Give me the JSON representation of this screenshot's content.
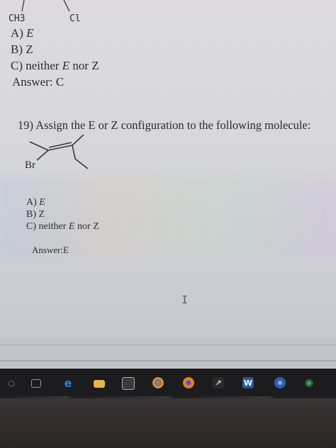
{
  "prev_question": {
    "left_label": "CH3",
    "right_label": "Cl",
    "options": {
      "a": "A) ",
      "a_val": "E",
      "b": "B) Z",
      "c": "C) neither ",
      "c_val": "E",
      "c_tail": " nor Z"
    },
    "answer": "Answer:  C"
  },
  "question_19": {
    "prompt": "19) Assign the E or Z configuration to the following molecule:",
    "molecule_label": "Br",
    "options": {
      "a": "A) ",
      "a_val": "E",
      "b": "B) Z",
      "c": "C) neither ",
      "c_val": "E",
      "c_tail": " nor Z"
    },
    "answer": "Answer:E"
  },
  "taskbar": {
    "icons": [
      "search-icon",
      "task-view-icon",
      "edge-browser-icon",
      "file-explorer-icon",
      "store-icon",
      "chrome-icon",
      "firefox-icon",
      "app-icon",
      "word-icon",
      "app-icon",
      "app-icon"
    ],
    "word_letter": "W"
  },
  "colors": {
    "page": "#d8d8dc",
    "text": "#2d2d2f",
    "taskbar": "#1c1b1d"
  }
}
